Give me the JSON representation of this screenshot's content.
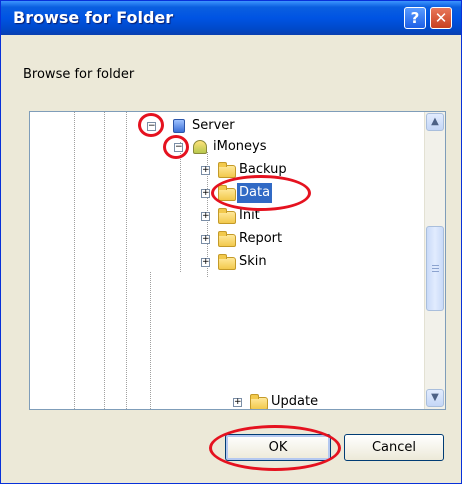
{
  "window": {
    "title": "Browse for Folder",
    "help_glyph": "?",
    "close_glyph": "✕"
  },
  "description": "Browse for folder",
  "tree": {
    "nodes": [
      {
        "label": "Server",
        "level": 0,
        "expanded": true,
        "icon": "server-icon"
      },
      {
        "label": "iMoneys",
        "level": 1,
        "expanded": true,
        "icon": "user-folder-icon"
      },
      {
        "label": "Backup",
        "level": 2,
        "expanded": false,
        "icon": "folder-icon"
      },
      {
        "label": "Data",
        "level": 2,
        "expanded": false,
        "icon": "folder-icon",
        "selected": true
      },
      {
        "label": "Init",
        "level": 2,
        "expanded": false,
        "icon": "folder-icon"
      },
      {
        "label": "Report",
        "level": 2,
        "expanded": false,
        "icon": "folder-icon"
      },
      {
        "label": "Skin",
        "level": 2,
        "expanded": false,
        "icon": "folder-icon"
      },
      {
        "label": "Update",
        "level": 2,
        "expanded": false,
        "icon": "folder-icon"
      }
    ],
    "expander_minus": "−",
    "expander_plus": "+"
  },
  "scrollbar": {
    "up_glyph": "▲",
    "down_glyph": "▼"
  },
  "buttons": {
    "ok": "OK",
    "cancel": "Cancel"
  },
  "annotations": {
    "color": "#e5121f"
  }
}
